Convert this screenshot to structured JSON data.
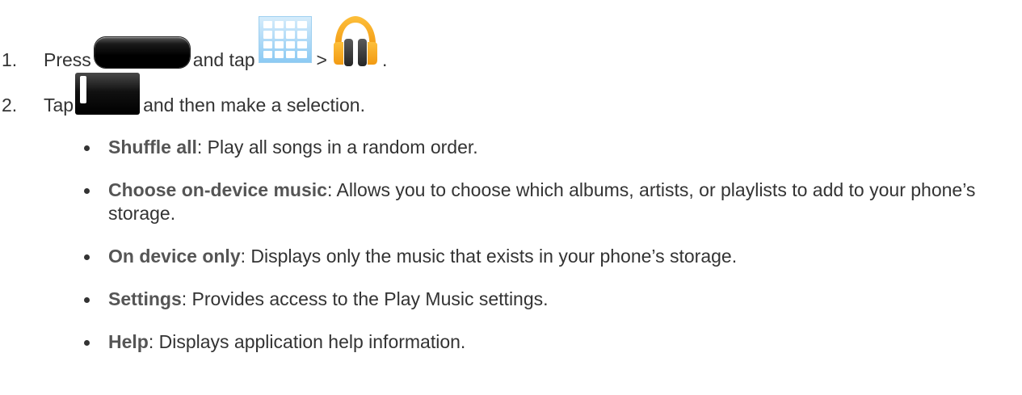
{
  "steps": [
    {
      "number": "1.",
      "parts": [
        "Press",
        "and tap",
        ">",
        "."
      ],
      "icons": [
        "home-key-icon",
        "apps-grid-icon",
        "play-music-headphones-icon"
      ]
    },
    {
      "number": "2.",
      "parts": [
        "Tap",
        "and then make a selection."
      ],
      "icons": [
        "menu-key-icon"
      ]
    }
  ],
  "options": [
    {
      "term": "Shuffle all",
      "description": ": Play all songs in a random order."
    },
    {
      "term": "Choose on-device music",
      "description": ": Allows you to choose which albums, artists, or playlists to add to your phone’s storage."
    },
    {
      "term": "On device only",
      "description": ": Displays only the music that exists in your phone’s storage."
    },
    {
      "term": "Settings",
      "description": ": Provides access to the Play Music settings."
    },
    {
      "term": "Help",
      "description": ": Displays application help information."
    }
  ],
  "colors": {
    "text": "#333333",
    "term": "#555555",
    "headphones_band": "#f5a623",
    "apps_grid": "#8ccaf3"
  }
}
